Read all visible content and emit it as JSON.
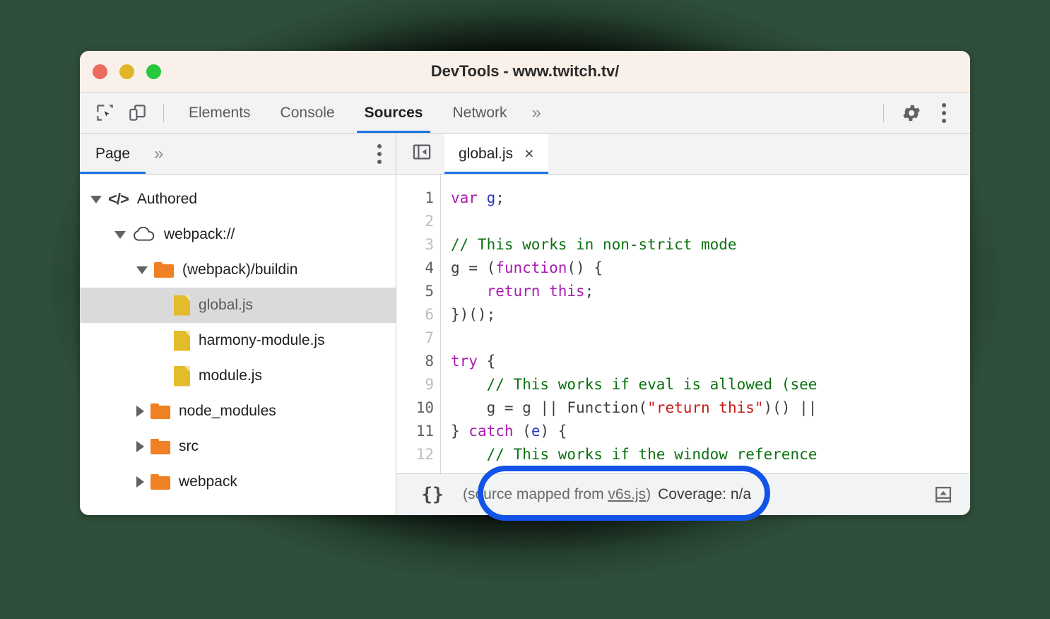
{
  "window": {
    "title": "DevTools - www.twitch.tv/",
    "controls": [
      {
        "name": "close",
        "color": "#ec6a5e"
      },
      {
        "name": "minimize",
        "color": "#e0b52a"
      },
      {
        "name": "maximize",
        "color": "#26c840"
      }
    ]
  },
  "toolbar": {
    "inspect_icon": "inspect-element-icon",
    "device_icon": "device-toolbar-icon",
    "tabs": [
      {
        "label": "Elements",
        "active": false
      },
      {
        "label": "Console",
        "active": false
      },
      {
        "label": "Sources",
        "active": true
      },
      {
        "label": "Network",
        "active": false
      }
    ],
    "more_tabs": "»",
    "settings_icon": "gear-icon",
    "menu_icon": "more-vertical-icon"
  },
  "sidebar": {
    "tabs": [
      {
        "label": "Page",
        "active": true
      }
    ],
    "more_tabs": "»",
    "menu_icon": "more-vertical-icon",
    "tree": [
      {
        "label": "Authored",
        "icon": "code-icon",
        "indent": 0,
        "twisty": "down",
        "selected": false
      },
      {
        "label": "webpack://",
        "icon": "cloud-icon",
        "indent": 1,
        "twisty": "down",
        "selected": false
      },
      {
        "label": "(webpack)/buildin",
        "icon": "folder-icon",
        "indent": 2,
        "twisty": "down",
        "selected": false
      },
      {
        "label": "global.js",
        "icon": "js-file-icon",
        "indent": 3,
        "twisty": "none",
        "selected": true
      },
      {
        "label": "harmony-module.js",
        "icon": "js-file-icon",
        "indent": 3,
        "twisty": "none",
        "selected": false
      },
      {
        "label": "module.js",
        "icon": "js-file-icon",
        "indent": 3,
        "twisty": "none",
        "selected": false
      },
      {
        "label": "node_modules",
        "icon": "folder-icon",
        "indent": 2,
        "twisty": "right",
        "selected": false
      },
      {
        "label": "src",
        "icon": "folder-icon",
        "indent": 2,
        "twisty": "right",
        "selected": false
      },
      {
        "label": "webpack",
        "icon": "folder-icon",
        "indent": 2,
        "twisty": "right",
        "selected": false
      }
    ]
  },
  "editor": {
    "collapse_icon": "collapse-sidebar-icon",
    "tab": {
      "label": "global.js",
      "close": "×"
    },
    "line_numbers": [
      {
        "n": "1",
        "exec": true
      },
      {
        "n": "2",
        "exec": false
      },
      {
        "n": "3",
        "exec": false
      },
      {
        "n": "4",
        "exec": true
      },
      {
        "n": "5",
        "exec": true
      },
      {
        "n": "6",
        "exec": false
      },
      {
        "n": "7",
        "exec": false
      },
      {
        "n": "8",
        "exec": true
      },
      {
        "n": "9",
        "exec": false
      },
      {
        "n": "10",
        "exec": true
      },
      {
        "n": "11",
        "exec": true
      },
      {
        "n": "12",
        "exec": false
      }
    ],
    "code_lines": [
      [
        {
          "t": "var",
          "c": "kw"
        },
        {
          "t": " "
        },
        {
          "t": "g",
          "c": "var"
        },
        {
          "t": ";"
        }
      ],
      [],
      [
        {
          "t": "// This works in non-strict mode",
          "c": "cm"
        }
      ],
      [
        {
          "t": "g = ("
        },
        {
          "t": "function",
          "c": "kw"
        },
        {
          "t": "() {"
        }
      ],
      [
        {
          "t": "    "
        },
        {
          "t": "return this",
          "c": "kw"
        },
        {
          "t": ";"
        }
      ],
      [
        {
          "t": "})();"
        }
      ],
      [],
      [
        {
          "t": "try",
          "c": "kw"
        },
        {
          "t": " {"
        }
      ],
      [
        {
          "t": "    "
        },
        {
          "t": "// This works if eval is allowed (see",
          "c": "cm"
        }
      ],
      [
        {
          "t": "    g = g || Function("
        },
        {
          "t": "\"return this\"",
          "c": "str"
        },
        {
          "t": ")() ||"
        }
      ],
      [
        {
          "t": "} "
        },
        {
          "t": "catch",
          "c": "kw"
        },
        {
          "t": " ("
        },
        {
          "t": "e",
          "c": "var"
        },
        {
          "t": ") {"
        }
      ],
      [
        {
          "t": "    "
        },
        {
          "t": "// This works if the window reference",
          "c": "cm"
        }
      ]
    ]
  },
  "statusbar": {
    "pretty_print": "{}",
    "source_mapped_prefix": "(source mapped from ",
    "source_mapped_link": "v6s.js",
    "source_mapped_suffix": ")",
    "coverage": "Coverage: n/a",
    "drawer_icon": "show-drawer-icon"
  },
  "annotation": {
    "color": "#1354e8",
    "shape": "rounded-rectangle-highlight",
    "targets": "source-mapped-status"
  }
}
